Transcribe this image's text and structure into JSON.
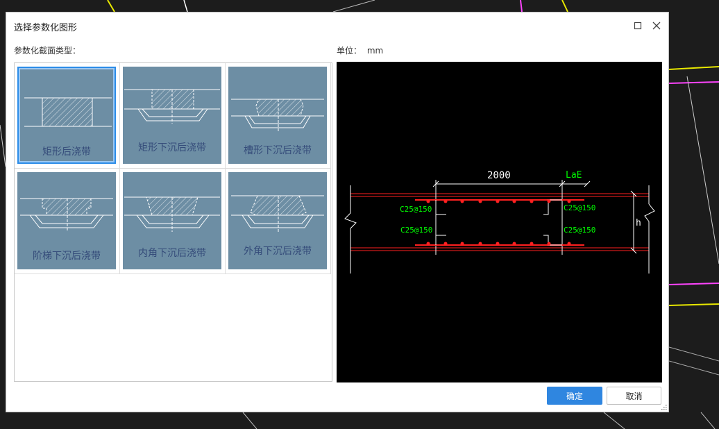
{
  "dialog": {
    "title": "选择参数化图形",
    "section_label": "参数化截面类型：",
    "unit_label": "单位：",
    "unit_value": "mm",
    "ok_label": "确定",
    "cancel_label": "取消"
  },
  "shapes": [
    {
      "label": "矩形后浇带",
      "selected": true
    },
    {
      "label": "矩形下沉后浇带",
      "selected": false
    },
    {
      "label": "槽形下沉后浇带",
      "selected": false
    },
    {
      "label": "阶梯下沉后浇带",
      "selected": false
    },
    {
      "label": "内角下沉后浇带",
      "selected": false
    },
    {
      "label": "外角下沉后浇带",
      "selected": false
    }
  ],
  "preview": {
    "dim_width": "2000",
    "dim_lae": "LaE",
    "rebar_tl": "C25@150",
    "rebar_tr": "C25@150",
    "rebar_bl": "C25@150",
    "rebar_br": "C25@150",
    "h_label": "h"
  },
  "colors": {
    "accent": "#2f86e0",
    "thumb": "#6d8ea4",
    "rebar": "#ff0000",
    "annot": "#00ff00"
  }
}
